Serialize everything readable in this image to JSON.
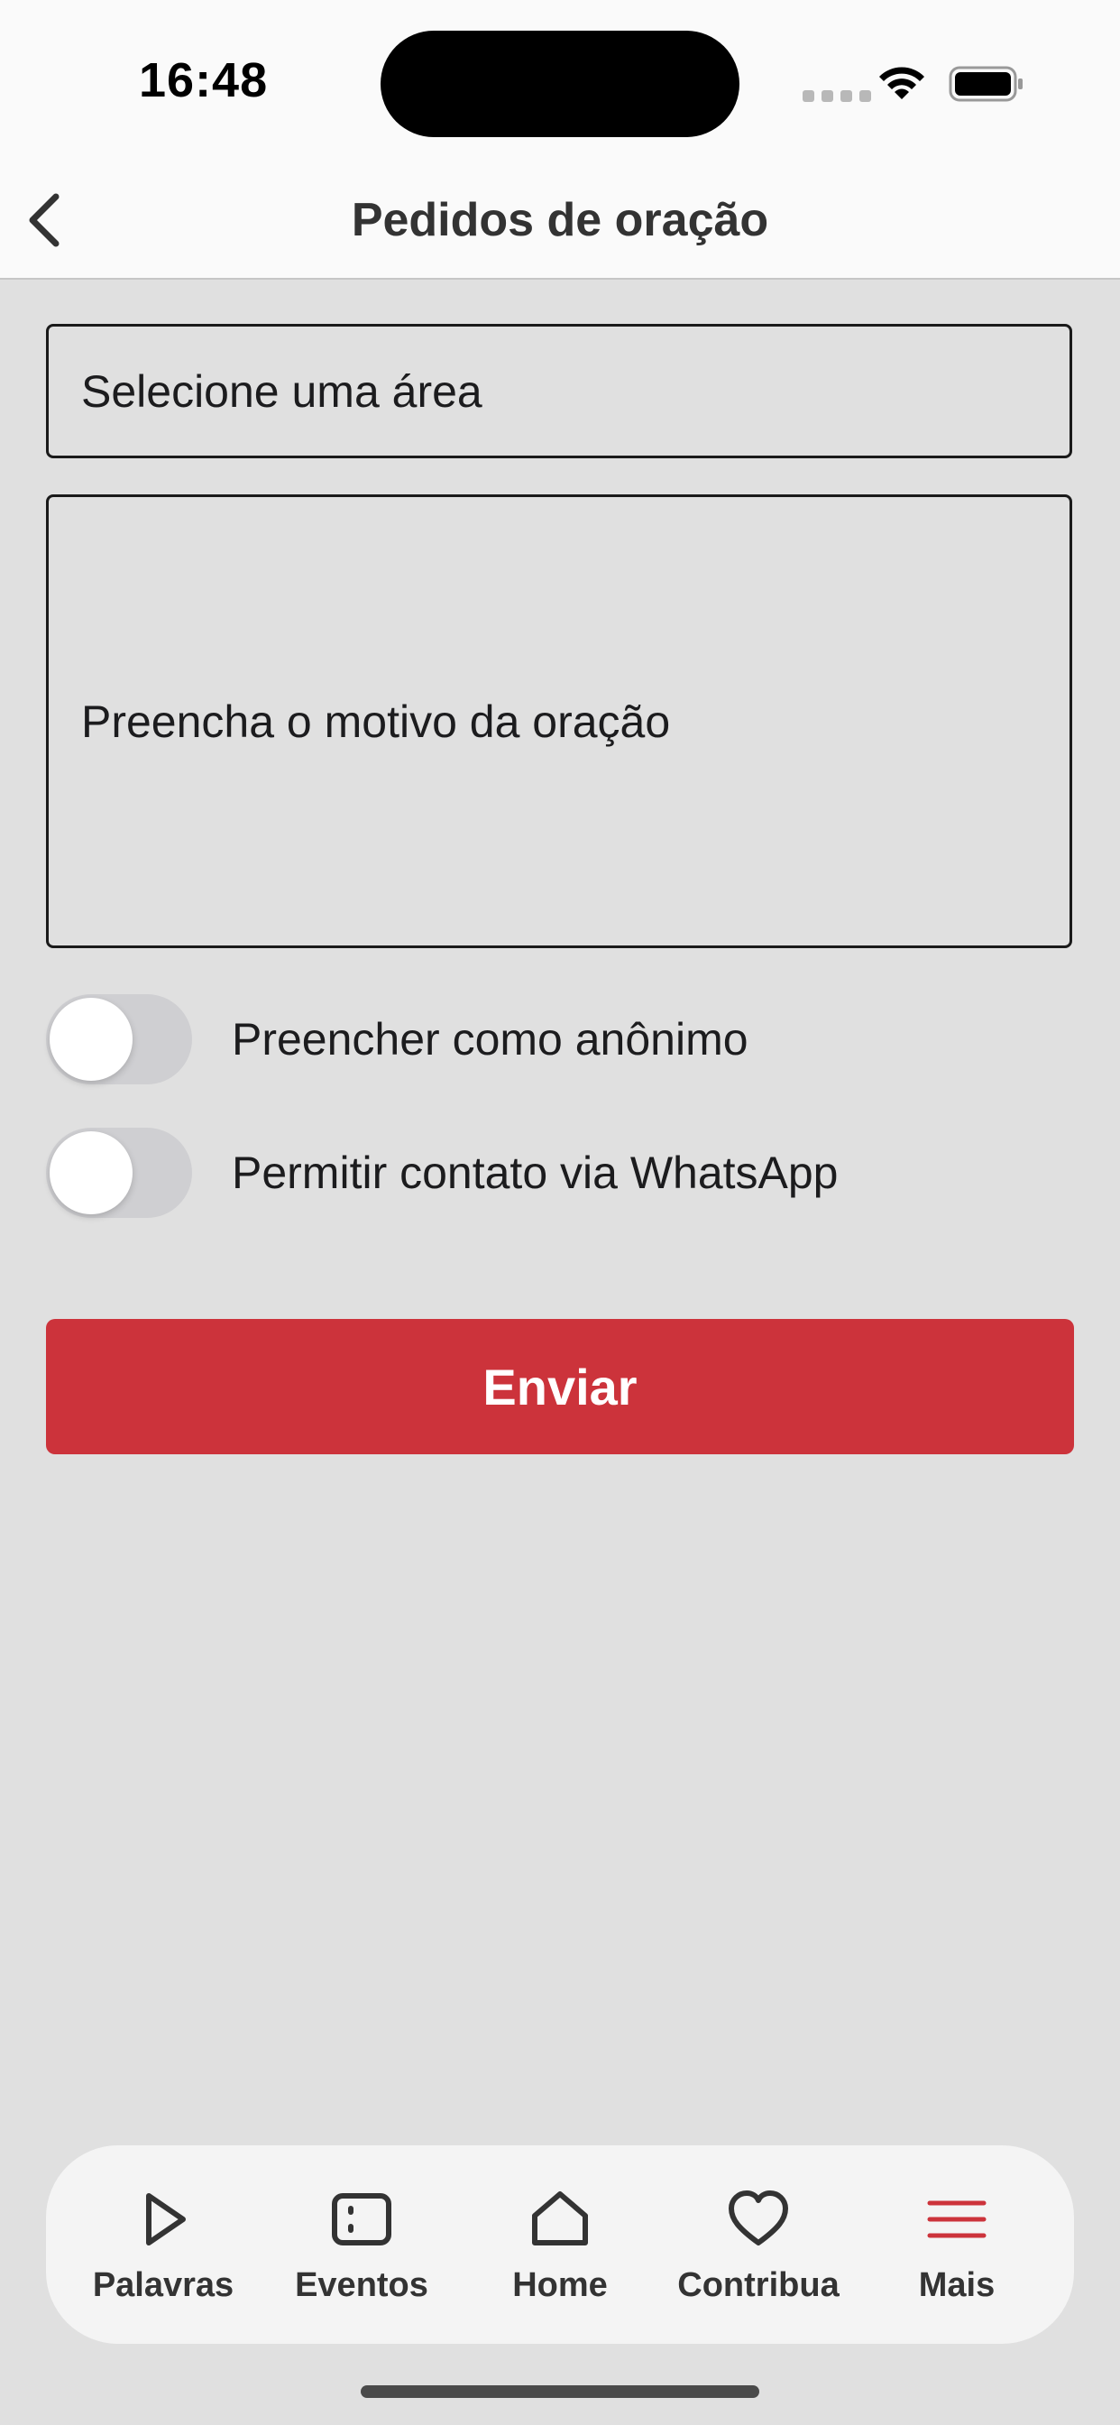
{
  "status_bar": {
    "time": "16:48"
  },
  "header": {
    "title": "Pedidos de oração"
  },
  "form": {
    "area_select_placeholder": "Selecione uma área",
    "reason_placeholder": "Preencha o motivo da oração",
    "toggles": [
      {
        "label": "Preencher como anônimo",
        "on": false
      },
      {
        "label": "Permitir contato via WhatsApp",
        "on": false
      }
    ],
    "submit_label": "Enviar"
  },
  "tab_bar": {
    "tabs": [
      {
        "label": "Palavras",
        "icon": "play-icon"
      },
      {
        "label": "Eventos",
        "icon": "calendar-icon"
      },
      {
        "label": "Home",
        "icon": "home-icon"
      },
      {
        "label": "Contribua",
        "icon": "heart-icon"
      },
      {
        "label": "Mais",
        "icon": "menu-icon",
        "active": true
      }
    ]
  },
  "colors": {
    "accent": "#cc333b",
    "background": "#e0e0e0",
    "bar_background": "#fafafa"
  }
}
